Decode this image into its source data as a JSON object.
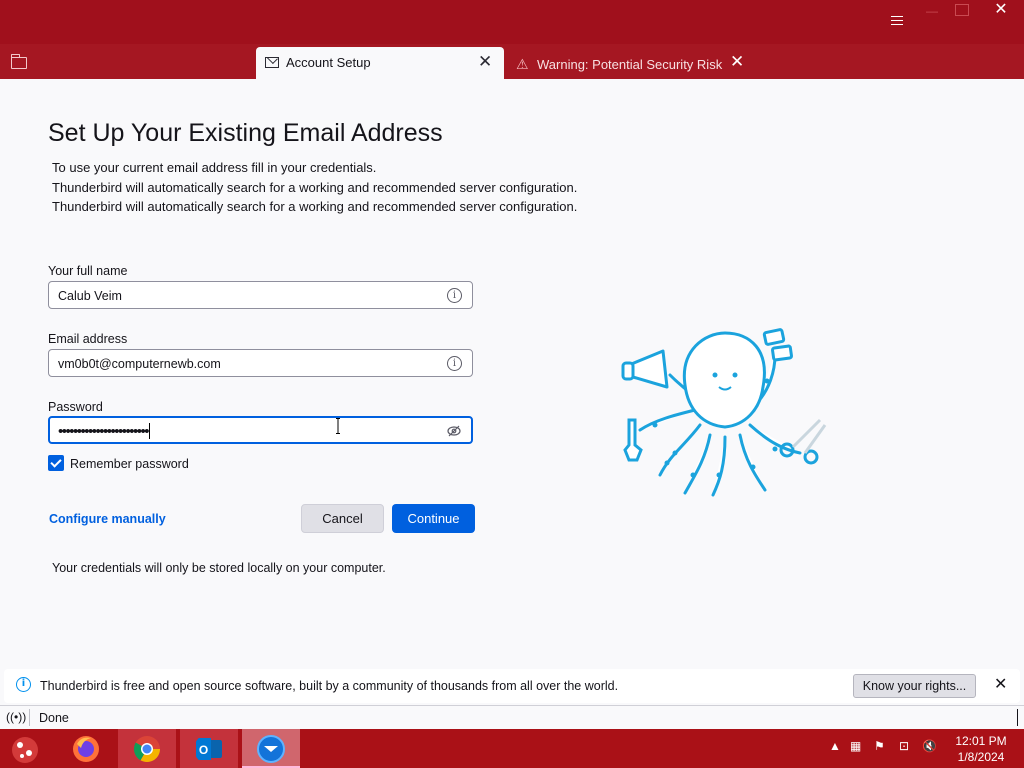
{
  "tabs": [
    {
      "label": "Account Setup",
      "active": true,
      "icon": "envelope-icon"
    },
    {
      "label": "Warning: Potential Security Risk Ahead",
      "active": false,
      "icon": "warning-icon"
    }
  ],
  "page": {
    "title": "Set Up Your Existing Email Address",
    "description": [
      "To use your current email address fill in your credentials.",
      "Thunderbird will automatically search for a working and recommended server configuration.",
      "Thunderbird will automatically search for a working and recommended server configuration."
    ]
  },
  "form": {
    "name_label": "Your full name",
    "name_value": "Calub Veim",
    "email_label": "Email address",
    "email_value": "vm0b0t@computernewb.com",
    "password_label": "Password",
    "password_value": "••••••••••••••••••••••••",
    "remember_label": "Remember password",
    "remember_checked": true
  },
  "actions": {
    "configure_manually": "Configure manually",
    "cancel": "Cancel",
    "continue": "Continue"
  },
  "note": "Your credentials will only be stored locally on your computer.",
  "notification": {
    "message": "Thunderbird is free and open source software, built by a community of thousands from all over the world.",
    "button": "Know your rights..."
  },
  "status": {
    "text": "Done"
  },
  "taskbar": {
    "apps": [
      "firefox-icon",
      "chrome-icon",
      "outlook-icon",
      "thunderbird-icon"
    ],
    "time": "12:01 PM",
    "date": "1/8/2024"
  },
  "colors": {
    "titlebar": "#a0101c",
    "accent": "#0060df",
    "taskbar": "#aa1117"
  }
}
